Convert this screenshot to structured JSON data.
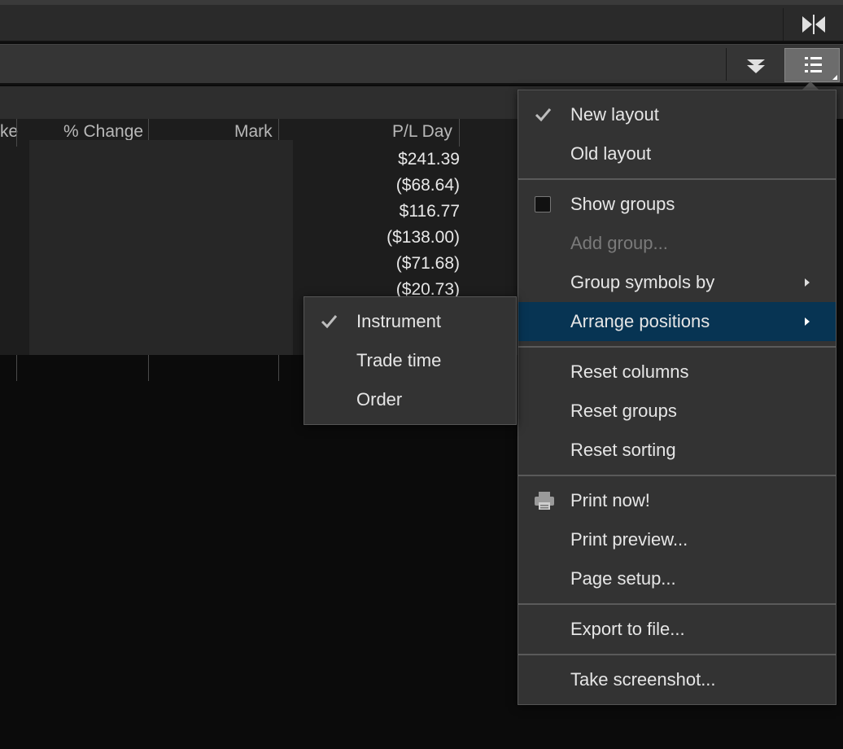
{
  "toolbar": {
    "collapse_icon": "collapse-horizontal-icon",
    "dropdown_icon": "double-chevron-down-icon",
    "menu_icon": "list-menu-icon"
  },
  "table": {
    "headers": {
      "partial": "ke",
      "pct_change": "% Change",
      "mark": "Mark",
      "pl_day": "P/L Day"
    },
    "pl_day_values": [
      "$241.39",
      "($68.64)",
      "$116.77",
      "($138.00)",
      "($71.68)",
      "($20.73)"
    ]
  },
  "main_menu": {
    "items": [
      {
        "label": "New layout",
        "checked": true
      },
      {
        "label": "Old layout"
      },
      {
        "label": "Show groups",
        "checkbox": true
      },
      {
        "label": "Add group...",
        "disabled": true
      },
      {
        "label": "Group symbols by",
        "submenu": true
      },
      {
        "label": "Arrange positions",
        "submenu": true,
        "active": true
      },
      {
        "label": "Reset columns"
      },
      {
        "label": "Reset groups"
      },
      {
        "label": "Reset sorting"
      },
      {
        "label": "Print now!",
        "icon": "printer-icon"
      },
      {
        "label": "Print preview..."
      },
      {
        "label": "Page setup..."
      },
      {
        "label": "Export to file..."
      },
      {
        "label": "Take screenshot..."
      }
    ]
  },
  "sub_menu": {
    "items": [
      {
        "label": "Instrument",
        "checked": true
      },
      {
        "label": "Trade time"
      },
      {
        "label": "Order"
      }
    ]
  },
  "colors": {
    "menu_bg": "#333333",
    "active_item": "#073453",
    "window_bg": "#0b0b0b"
  }
}
